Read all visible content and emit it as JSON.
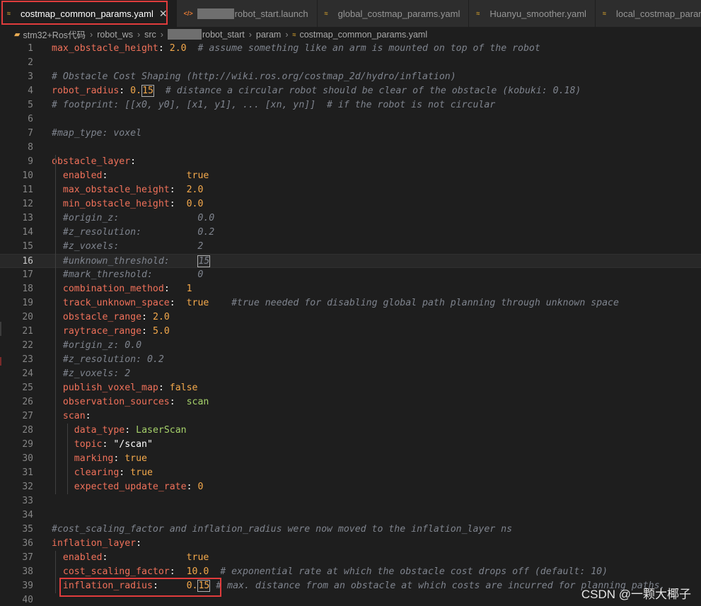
{
  "tabs": [
    {
      "icon": "yaml-icon",
      "title": "costmap_common_params.yaml",
      "active": true,
      "close": "✕"
    },
    {
      "icon": "xml-icon",
      "title": "robot_start.launch",
      "active": false,
      "blurred_prefix": true
    },
    {
      "icon": "yaml-icon",
      "title": "global_costmap_params.yaml",
      "active": false
    },
    {
      "icon": "yaml-icon",
      "title": "Huanyu_smoother.yaml",
      "active": false
    },
    {
      "icon": "yaml-icon",
      "title": "local_costmap_params.yaml",
      "active": false
    }
  ],
  "breadcrumb": [
    "stm32+Ros代码",
    "robot_ws",
    "src",
    "robot_start",
    "param",
    "costmap_common_params.yaml"
  ],
  "cursor_line": 16,
  "watermark": "CSDN @一颗大椰子",
  "colors": {
    "key": "#f0715a",
    "value": "#f4a94b",
    "comment": "#7f848e",
    "string": "#a6d16a",
    "highlight_box": "#e03c3c"
  },
  "lines": [
    [
      [
        "k",
        "max_obstacle_height"
      ],
      [
        "p",
        ": "
      ],
      [
        "v",
        "2.0"
      ],
      [
        "c",
        "  # assume something like an arm is mounted on top of the robot"
      ]
    ],
    [],
    [
      [
        "c",
        "# Obstacle Cost Shaping (http://wiki.ros.org/costmap_2d/hydro/inflation)"
      ]
    ],
    [
      [
        "k",
        "robot_radius"
      ],
      [
        "p",
        ": "
      ],
      [
        "v",
        "0."
      ],
      [
        "vb",
        "15"
      ],
      [
        "c",
        "  # distance a circular robot should be clear of the obstacle (kobuki: 0.18)"
      ]
    ],
    [
      [
        "c",
        "# footprint: [[x0, y0], [x1, y1], ... [xn, yn]]  # if the robot is not circular"
      ]
    ],
    [],
    [
      [
        "c",
        "#map_type: voxel"
      ]
    ],
    [],
    [
      [
        "k",
        "obstacle_layer"
      ],
      [
        "p",
        ":"
      ]
    ],
    [
      [
        "p",
        "  "
      ],
      [
        "k",
        "enabled"
      ],
      [
        "p",
        ":              "
      ],
      [
        "v",
        "true"
      ]
    ],
    [
      [
        "p",
        "  "
      ],
      [
        "k",
        "max_obstacle_height"
      ],
      [
        "p",
        ":  "
      ],
      [
        "v",
        "2.0"
      ]
    ],
    [
      [
        "p",
        "  "
      ],
      [
        "k",
        "min_obstacle_height"
      ],
      [
        "p",
        ":  "
      ],
      [
        "v",
        "0.0"
      ]
    ],
    [
      [
        "c",
        "  #origin_z:              0.0"
      ]
    ],
    [
      [
        "c",
        "  #z_resolution:          0.2"
      ]
    ],
    [
      [
        "c",
        "  #z_voxels:              2"
      ]
    ],
    [
      [
        "c",
        "  #unknown_threshold:     "
      ],
      [
        "cb",
        "15"
      ]
    ],
    [
      [
        "c",
        "  #mark_threshold:        0"
      ]
    ],
    [
      [
        "p",
        "  "
      ],
      [
        "k",
        "combination_method"
      ],
      [
        "p",
        ":   "
      ],
      [
        "v",
        "1"
      ]
    ],
    [
      [
        "p",
        "  "
      ],
      [
        "k",
        "track_unknown_space"
      ],
      [
        "p",
        ":  "
      ],
      [
        "v",
        "true"
      ],
      [
        "c",
        "    #true needed for disabling global path planning through unknown space"
      ]
    ],
    [
      [
        "p",
        "  "
      ],
      [
        "k",
        "obstacle_range"
      ],
      [
        "p",
        ": "
      ],
      [
        "v",
        "2.0"
      ]
    ],
    [
      [
        "p",
        "  "
      ],
      [
        "k",
        "raytrace_range"
      ],
      [
        "p",
        ": "
      ],
      [
        "v",
        "5.0"
      ]
    ],
    [
      [
        "c",
        "  #origin_z: 0.0"
      ]
    ],
    [
      [
        "c",
        "  #z_resolution: 0.2"
      ]
    ],
    [
      [
        "c",
        "  #z_voxels: 2"
      ]
    ],
    [
      [
        "p",
        "  "
      ],
      [
        "k",
        "publish_voxel_map"
      ],
      [
        "p",
        ": "
      ],
      [
        "v",
        "false"
      ]
    ],
    [
      [
        "p",
        "  "
      ],
      [
        "k",
        "observation_sources"
      ],
      [
        "p",
        ":  "
      ],
      [
        "s",
        "scan"
      ]
    ],
    [
      [
        "p",
        "  "
      ],
      [
        "k",
        "scan"
      ],
      [
        "p",
        ":"
      ]
    ],
    [
      [
        "p",
        "    "
      ],
      [
        "k",
        "data_type"
      ],
      [
        "p",
        ": "
      ],
      [
        "s",
        "LaserScan"
      ]
    ],
    [
      [
        "p",
        "    "
      ],
      [
        "k",
        "topic"
      ],
      [
        "p",
        ": "
      ],
      [
        "p",
        "\"/scan\""
      ]
    ],
    [
      [
        "p",
        "    "
      ],
      [
        "k",
        "marking"
      ],
      [
        "p",
        ": "
      ],
      [
        "v",
        "true"
      ]
    ],
    [
      [
        "p",
        "    "
      ],
      [
        "k",
        "clearing"
      ],
      [
        "p",
        ": "
      ],
      [
        "v",
        "true"
      ]
    ],
    [
      [
        "p",
        "    "
      ],
      [
        "k",
        "expected_update_rate"
      ],
      [
        "p",
        ": "
      ],
      [
        "v",
        "0"
      ]
    ],
    [],
    [],
    [
      [
        "c",
        "#cost_scaling_factor and inflation_radius were now moved to the inflation_layer ns"
      ]
    ],
    [
      [
        "k",
        "inflation_layer"
      ],
      [
        "p",
        ":"
      ]
    ],
    [
      [
        "p",
        "  "
      ],
      [
        "k",
        "enabled"
      ],
      [
        "p",
        ":              "
      ],
      [
        "v",
        "true"
      ]
    ],
    [
      [
        "p",
        "  "
      ],
      [
        "k",
        "cost_scaling_factor"
      ],
      [
        "p",
        ":  "
      ],
      [
        "v",
        "10.0"
      ],
      [
        "c",
        "  # exponential rate at which the obstacle cost drops off (default: 10)"
      ]
    ],
    [
      [
        "p",
        "  "
      ],
      [
        "k",
        "inflation_radius"
      ],
      [
        "p",
        ":     "
      ],
      [
        "v",
        "0."
      ],
      [
        "vb",
        "15"
      ],
      [
        "c",
        " # max. distance from an obstacle at which costs are incurred for planning paths."
      ]
    ],
    []
  ]
}
